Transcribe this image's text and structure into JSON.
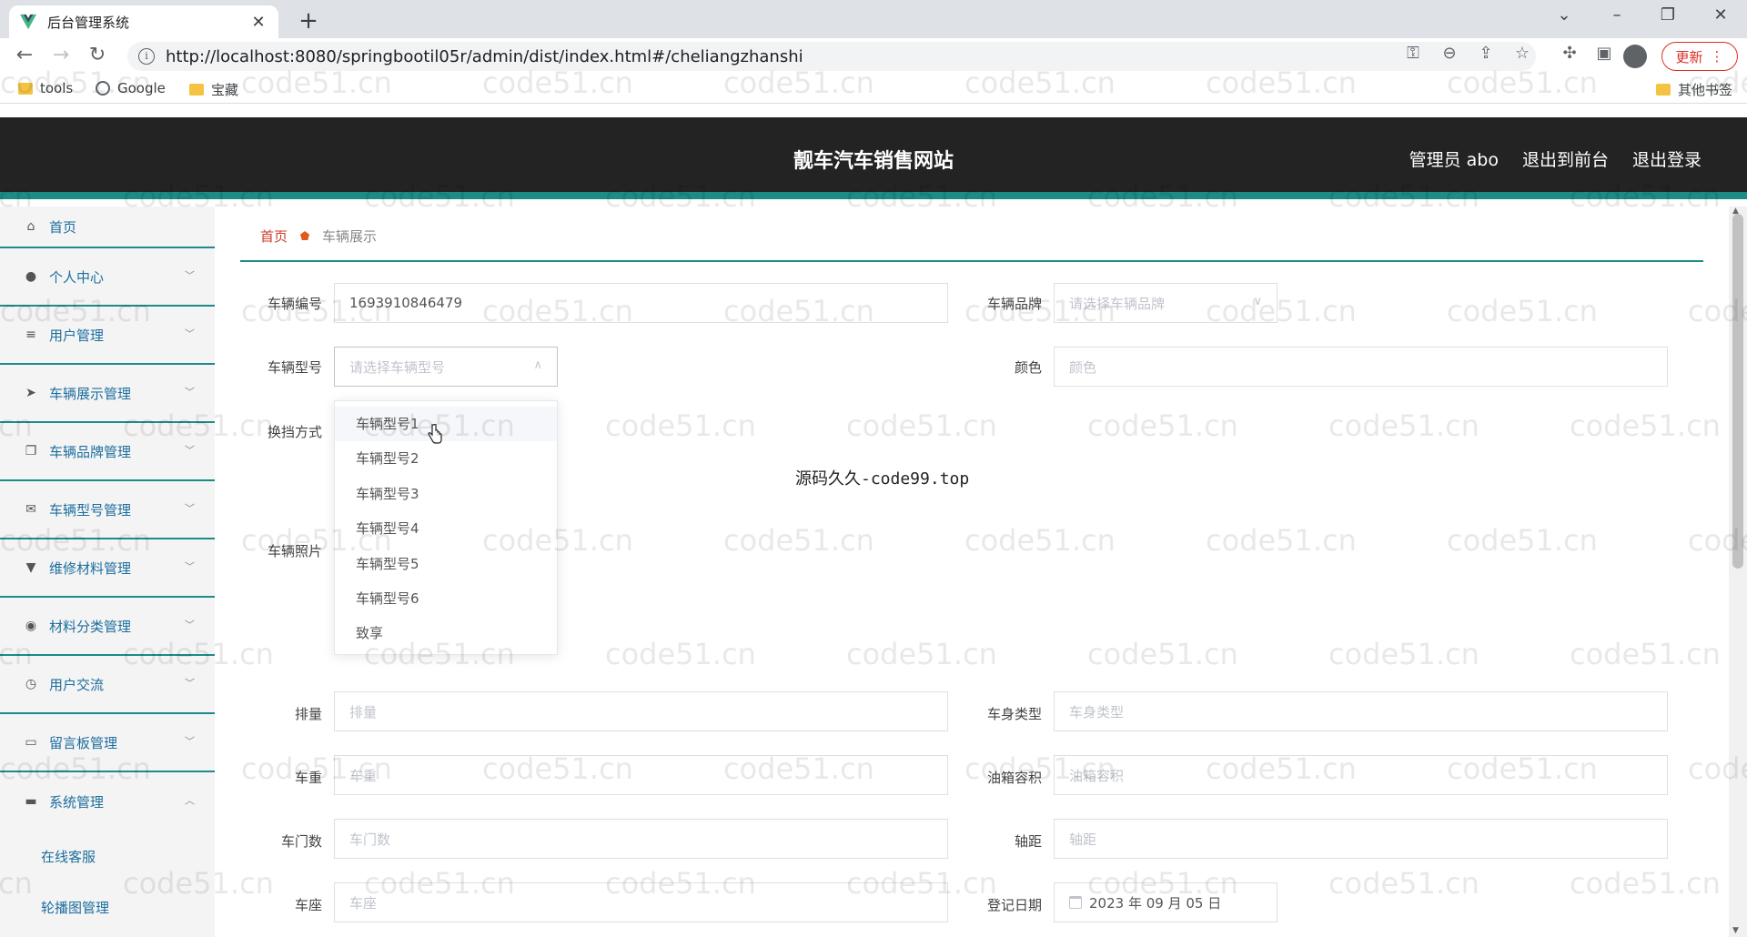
{
  "browser": {
    "tab_title": "后台管理系统",
    "url": "http://localhost:8080/springbootil05r/admin/dist/index.html#/cheliangzhanshi",
    "update_label": "更新",
    "bookmarks": [
      {
        "label": "tools",
        "icon": "folder-icon"
      },
      {
        "label": "Google",
        "icon": "globe-icon"
      },
      {
        "label": "宝藏",
        "icon": "folder-icon"
      }
    ],
    "other_bookmarks": "其他书签"
  },
  "header": {
    "title": "靓车汽车销售网站",
    "admin": "管理员 abo",
    "to_front": "退出到前台",
    "logout": "退出登录"
  },
  "sidebar": {
    "items": [
      {
        "label": "首页",
        "icon": "home-icon"
      },
      {
        "label": "个人中心",
        "icon": "user-icon"
      },
      {
        "label": "用户管理",
        "icon": "list-icon"
      },
      {
        "label": "车辆展示管理",
        "icon": "send-icon"
      },
      {
        "label": "车辆品牌管理",
        "icon": "copy-icon"
      },
      {
        "label": "车辆型号管理",
        "icon": "mail-icon"
      },
      {
        "label": "维修材料管理",
        "icon": "pin-icon"
      },
      {
        "label": "材料分类管理",
        "icon": "compass-icon"
      },
      {
        "label": "用户交流",
        "icon": "clock-icon"
      },
      {
        "label": "留言板管理",
        "icon": "board-icon"
      },
      {
        "label": "系统管理",
        "icon": "chat-icon"
      }
    ],
    "subitems": [
      "在线客服",
      "轮播图管理"
    ]
  },
  "breadcrumb": {
    "home": "首页",
    "current": "车辆展示"
  },
  "form": {
    "vehicle_no": {
      "label": "车辆编号",
      "value": "1693910846479"
    },
    "brand": {
      "label": "车辆品牌",
      "placeholder": "请选择车辆品牌"
    },
    "model": {
      "label": "车辆型号",
      "placeholder": "请选择车辆型号"
    },
    "color": {
      "label": "颜色",
      "placeholder": "颜色"
    },
    "gearbox": {
      "label": "换挡方式"
    },
    "photo": {
      "label": "车辆照片"
    },
    "displacement": {
      "label": "排量",
      "placeholder": "排量"
    },
    "body_type": {
      "label": "车身类型",
      "placeholder": "车身类型"
    },
    "weight": {
      "label": "车重",
      "placeholder": "车重"
    },
    "tank": {
      "label": "油箱容积",
      "placeholder": "油箱容积"
    },
    "doors": {
      "label": "车门数",
      "placeholder": "车门数"
    },
    "wheelbase": {
      "label": "轴距",
      "placeholder": "轴距"
    },
    "seats": {
      "label": "车座",
      "placeholder": "车座"
    },
    "reg_date": {
      "label": "登记日期",
      "value": "2023 年 09 月 05 日"
    }
  },
  "dropdown": {
    "options": [
      "车辆型号1",
      "车辆型号2",
      "车辆型号3",
      "车辆型号4",
      "车辆型号5",
      "车辆型号6",
      "致享"
    ]
  },
  "watermark": {
    "site": "code51.cn",
    "center": "源码久久-code99.top"
  }
}
